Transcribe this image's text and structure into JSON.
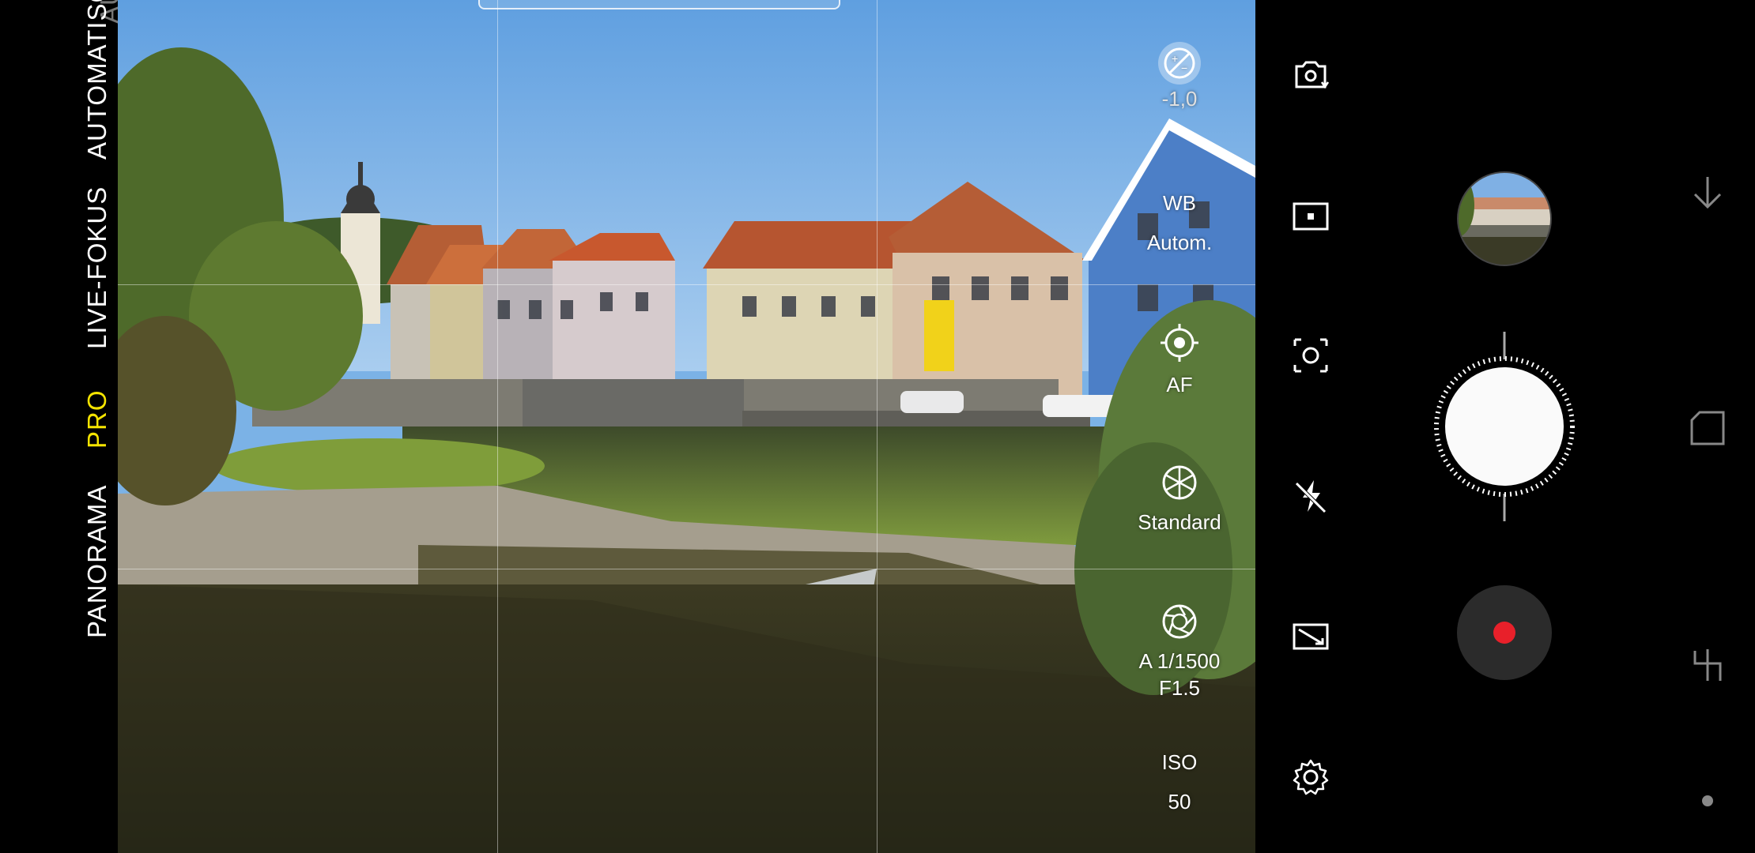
{
  "modes": {
    "partial_top": "AUTOMATISCH",
    "automatic": "AUTOMATISCH",
    "live_focus": "LIVE-FOKUS",
    "pro": "PRO",
    "panorama": "PANORAMA"
  },
  "pro_controls": {
    "exposure": "-1,0",
    "wb_title": "WB",
    "wb_value": "Autom.",
    "af_label": "AF",
    "tone_label": "Standard",
    "shutter_value": "A 1/1500",
    "aperture_value": "F1.5",
    "iso_title": "ISO",
    "iso_value": "50"
  },
  "icons": {
    "switch_camera": "switch-camera-icon",
    "aspect_ratio": "aspect-ratio-icon",
    "metering": "metering-icon",
    "flash_off": "flash-off-icon",
    "filter": "filter-icon",
    "settings": "gear-icon",
    "back": "nav-back-icon",
    "recents": "nav-recents-icon",
    "home": "nav-home-icon"
  },
  "colors": {
    "active_mode": "#f5e400",
    "record_dot": "#e8202a"
  }
}
